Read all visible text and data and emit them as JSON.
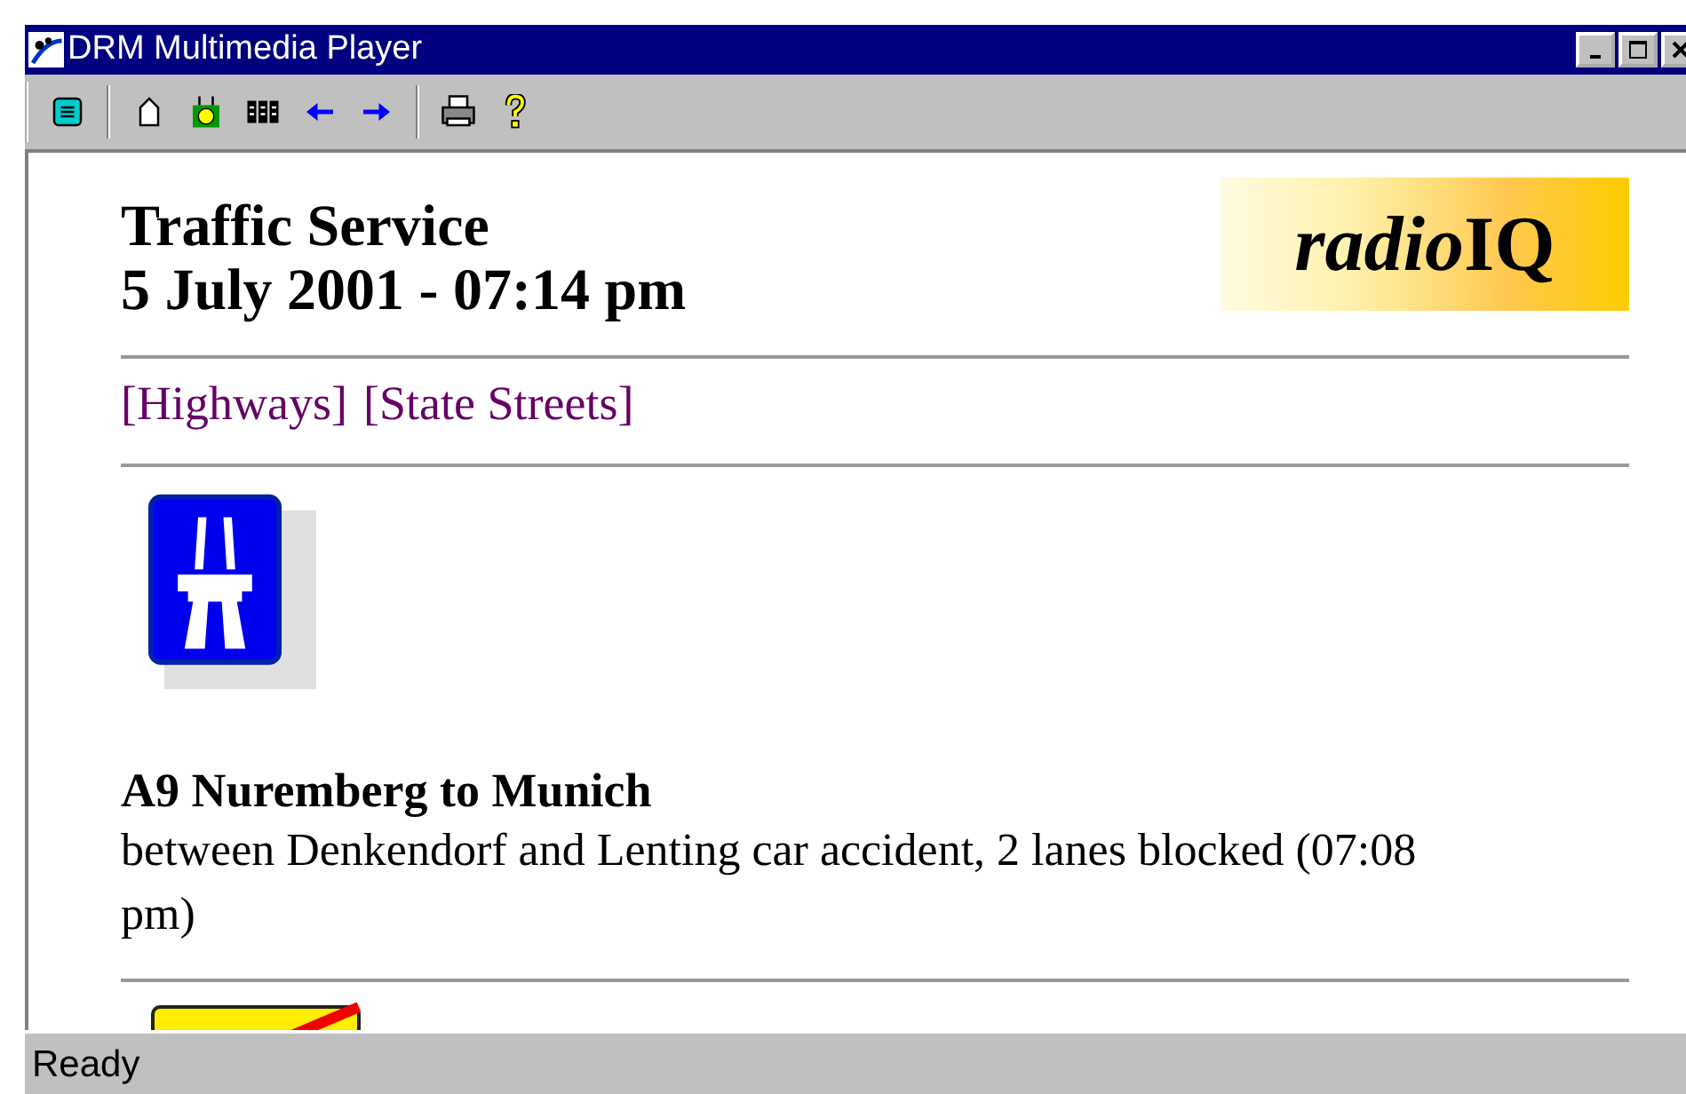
{
  "window": {
    "title": "DRM Multimedia Player"
  },
  "toolbar": {
    "buttons": [
      {
        "kind": "list"
      },
      {
        "kind": "home"
      },
      {
        "kind": "face"
      },
      {
        "kind": "grid"
      },
      {
        "kind": "back"
      },
      {
        "kind": "forward"
      },
      {
        "kind": "print"
      },
      {
        "kind": "help"
      }
    ]
  },
  "page": {
    "title": "Traffic Service",
    "date": "5 July 2001 - 07:14 pm",
    "logo": {
      "part1": "radio",
      "part2": "IQ"
    },
    "links": [
      "[Highways]",
      "[State Streets]"
    ],
    "messages": [
      {
        "road": "A9 Nuremberg to Munich",
        "text": "between Denkendorf and Lenting car accident, 2 lanes blocked (07:08 pm)"
      }
    ]
  },
  "status_bar": {
    "text": "Ready"
  }
}
